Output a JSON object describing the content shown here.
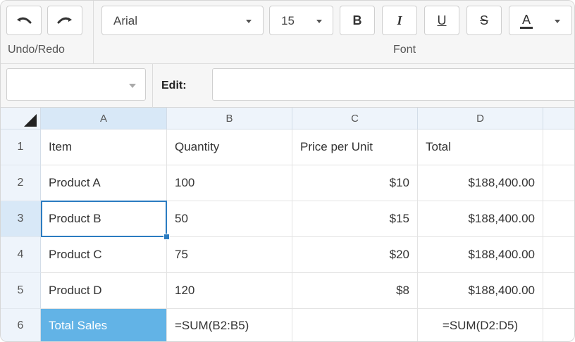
{
  "ribbon": {
    "undo_redo_label": "Undo/Redo",
    "font_label": "Font",
    "font_family": "Arial",
    "font_size": "15",
    "bold_label": "B",
    "italic_label": "I",
    "underline_label": "U",
    "strike_label": "S",
    "font_color_label": "A"
  },
  "formula_bar": {
    "name_box_value": "",
    "edit_label": "Edit:",
    "edit_value": ""
  },
  "columns": [
    "A",
    "B",
    "C",
    "D"
  ],
  "rows": [
    {
      "num": "1",
      "cells": [
        "Item",
        "Quantity",
        "Price per Unit",
        "Total"
      ]
    },
    {
      "num": "2",
      "cells": [
        "Product A",
        "100",
        "$10",
        "$188,400.00"
      ]
    },
    {
      "num": "3",
      "cells": [
        "Product B",
        "50",
        "$15",
        "$188,400.00"
      ]
    },
    {
      "num": "4",
      "cells": [
        "Product C",
        "75",
        "$20",
        "$188,400.00"
      ]
    },
    {
      "num": "5",
      "cells": [
        "Product D",
        "120",
        "$8",
        "$188,400.00"
      ]
    },
    {
      "num": "6",
      "cells": [
        "Total Sales",
        "=SUM(B2:B5)",
        "",
        "=SUM(D2:D5)"
      ]
    }
  ],
  "selected_cell": "A3",
  "colors": {
    "accent": "#2b7cc1",
    "highlight_cell": "#62b3e6",
    "header_bg": "#eef4fb",
    "header_selected": "#d8e8f7"
  }
}
